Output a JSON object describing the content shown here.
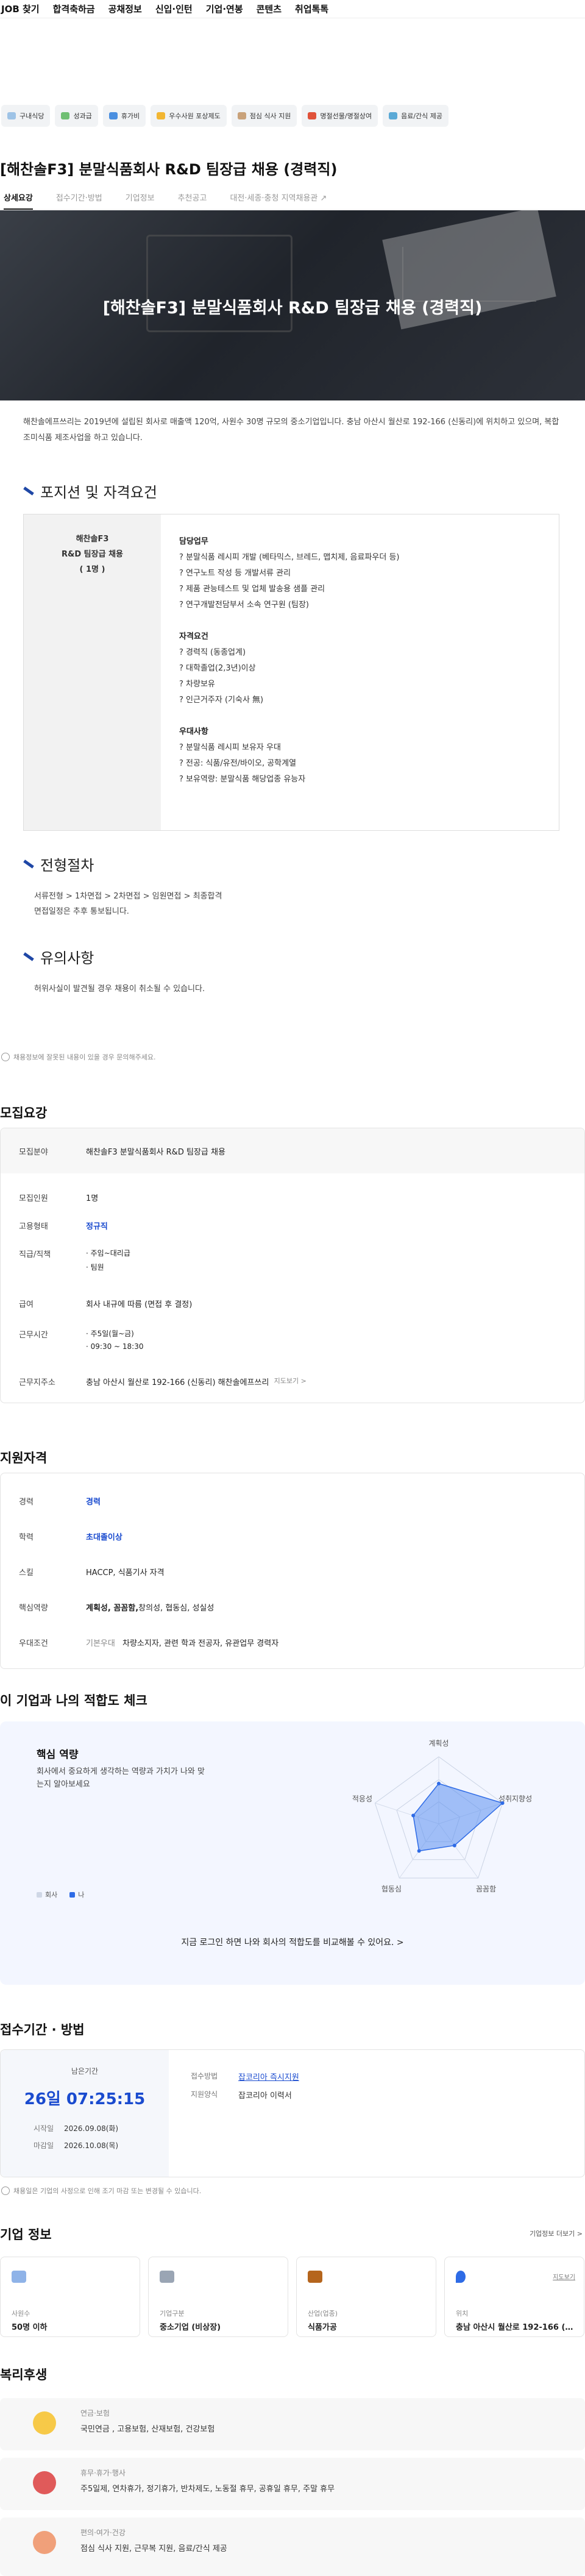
{
  "nav": [
    "JOB 찾기",
    "합격축하금",
    "공채정보",
    "신입·인턴",
    "기업·연봉",
    "콘텐츠",
    "취업톡톡"
  ],
  "benefits": [
    {
      "label": "구내식당",
      "color": "#9ec3e6"
    },
    {
      "label": "성과급",
      "color": "#6fbf73"
    },
    {
      "label": "휴가비",
      "color": "#4a8fe0"
    },
    {
      "label": "우수사원 포상제도",
      "color": "#f2b632"
    },
    {
      "label": "점심 식사 지원",
      "color": "#c9a27a"
    },
    {
      "label": "명절선물/명절상여",
      "color": "#e0523a"
    },
    {
      "label": "음료/간식 제공",
      "color": "#5aa9d6"
    }
  ],
  "job": {
    "title": "[해찬솔F3] 분말식품회사 R&D 팀장급 채용 (경력직)"
  },
  "tabs": [
    "상세요강",
    "접수기간·방법",
    "기업정보",
    "추천공고",
    "대전·세종·충청 지역채용관"
  ],
  "detail": {
    "intro": "해찬솔에프쓰리는 2019년에 설립된 회사로 매출액 120억, 사원수 30명 규모의 중소기업입니다. 충남 아산시 월산로 192-166 (신동리)에 위치하고 있으며, 복합조미식품 제조사업을 하고 있습니다.",
    "position_heading": "포지션 및 자격요건",
    "pos_left": [
      "해찬솔F3",
      "R&D 팀장급 채용",
      "( 1명 )"
    ],
    "duty_label": "담당업무",
    "duties": [
      "? 분말식품 레시피 개발 (베타믹스, 브레드, 맵치제, 음료파우더 등)",
      "? 연구노트 작성 등 개발서류 관리",
      "? 제품 관능테스트 및 업체 발송용 샘플 관리",
      "? 연구개발전담부서 소속 연구원 (팀장)"
    ],
    "req_label": "자격요건",
    "reqs": [
      "? 경력직 (동종업계)",
      "? 대학졸업(2,3년)이상",
      "? 차량보유",
      "? 인근거주자 (기숙사 無)"
    ],
    "pref_label": "우대사항",
    "prefs": [
      "? 분말식품 레시피 보유자 우대",
      "? 전공: 식품/유전/바이오, 공학계열",
      "? 보유역량: 분말식품 해당업종 유능자"
    ],
    "process_heading": "전형절차",
    "process": [
      "서류전형 > 1차면접 > 2차면접 > 임원면접 > 최종합격",
      "면접일정은 추후 통보됩니다."
    ],
    "caution_heading": "유의사항",
    "caution": "허위사실이 발견될 경우 채용이 취소될 수 있습니다."
  },
  "note": "채용정보에 잘못된 내용이 있을 경우 문의해주세요.",
  "summary": {
    "heading": "모집요강",
    "rows": [
      {
        "k": "모집분야",
        "v": "해찬솔F3 분말식품회사 R&D 팀장급 채용"
      },
      {
        "k": "모집인원",
        "v": "1명"
      },
      {
        "k": "고용형태",
        "v": "정규직"
      },
      {
        "k": "직급/직책",
        "v1": "· 주임~대리급",
        "v2": "· 팀원"
      },
      {
        "k": "급여",
        "v": "회사 내규에 따름 (면접 후 결정)"
      },
      {
        "k": "근무시간",
        "v1": "· 주5일(월~금)",
        "v2": "· 09:30 ~ 18:30"
      },
      {
        "k": "근무지주소",
        "v": "충남 아산시 월산로 192-166 (신동리) 해찬솔에프쓰리",
        "link": "지도보기 >"
      }
    ]
  },
  "qual": {
    "heading": "지원자격",
    "rows": [
      {
        "k": "경력",
        "v": "경력"
      },
      {
        "k": "학력",
        "v": "초대졸이상"
      },
      {
        "k": "스킬",
        "v": "HACCP, 식품기사 자격"
      },
      {
        "k": "핵심역량",
        "bold": "계획성, 꼼꼼함,",
        "v": " 창의성, 협동심, 성실성"
      },
      {
        "k": "우대조건",
        "sub": "기본우대",
        "v": "차량소지자, 관련 학과 전공자, 유관업무 경력자"
      }
    ]
  },
  "fit": {
    "heading": "이 기업과 나의 적합도 체크",
    "title": "핵심 역량",
    "desc": "회사에서 중요하게 생각하는 역량과 가치가 나와 맞는지 알아보세요",
    "legend": [
      "회사",
      "나"
    ],
    "login": "지금 로그인 하면 나와 회사의 적합도를 비교해볼 수 있어요.  >"
  },
  "chart_data": {
    "type": "radar",
    "axes": [
      "계획성",
      "성취지향성",
      "꼼꼼함",
      "협동심",
      "적응성"
    ],
    "series": [
      {
        "name": "회사",
        "values": [
          0.6,
          1.0,
          0.4,
          0.5,
          0.4
        ]
      }
    ]
  },
  "apply": {
    "heading": "접수기간 · 방법",
    "remain_label": "남은기간",
    "remain": "26일 07:25:15",
    "start_label": "시작일",
    "start": "2026.09.08(화)",
    "end_label": "마감일",
    "end": "2026.10.08(목)",
    "method_label": "접수방법",
    "method": "잡코리아 즉시지원",
    "form_label": "지원양식",
    "form": "잡코리아 이력서",
    "note": "채용일은 기업의 사정으로 인해 조기 마감 또는 변경될 수 있습니다."
  },
  "company": {
    "heading": "기업 정보",
    "more": "기업정보 더보기 >",
    "cards": [
      {
        "l": "사원수",
        "v": "50명 이하",
        "color": "#8fb3e8"
      },
      {
        "l": "기업구분",
        "v": "중소기업 (비상장)",
        "color": "#9aa5b4"
      },
      {
        "l": "산업(업종)",
        "v": "식품가공",
        "color": "#b5651d"
      },
      {
        "l": "위치",
        "v": "충남 아산시 월산로 192-166 (신동리)",
        "color": "#2e6be6",
        "map": "지도보기"
      }
    ]
  },
  "welfare": {
    "heading": "복리후생",
    "items": [
      {
        "l": "연금·보험",
        "v": "국민연금 , 고용보험, 산재보험, 건강보험",
        "color": "#f7c948"
      },
      {
        "l": "휴무·휴가·행사",
        "v": "주5일제, 연차휴가, 정기휴가, 반차제도, 노동절 휴무, 공휴일 휴무, 주말 휴무",
        "color": "#e05a5a"
      },
      {
        "l": "편의·여가·건강",
        "v": "점심 식사 지원, 근무복 지원, 음료/간식 제공",
        "color": "#f0a07a"
      }
    ]
  }
}
